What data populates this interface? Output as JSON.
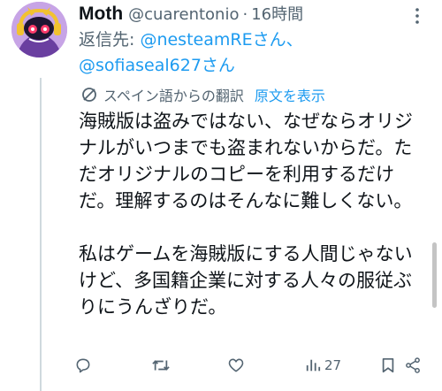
{
  "tweet": {
    "author_name": "Moth",
    "handle": "@cuarentonio",
    "separator": "·",
    "time": "16時間",
    "reply_prefix": "返信先: ",
    "mention_1": "@nesteamREさん、",
    "mention_2": "@sofiaseal627さん",
    "translated_from": "スペイン語からの翻訳",
    "show_original": "原文を表示",
    "paragraph_1": "海賊版は盗みではない、なぜならオリジナルがいつまでも盗まれないからだ。ただオリジナルのコピーを利用するだけだ。理解するのはそんなに難しくない。",
    "paragraph_2": "私はゲームを海賊版にする人間じゃないけど、多国籍企業に対する人々の服従ぶりにうんざりだ。",
    "views_count": "27"
  },
  "icons": [
    "more-icon",
    "translate-icon",
    "reply-icon",
    "retweet-icon",
    "like-icon",
    "views-icon",
    "bookmark-icon",
    "share-icon"
  ],
  "colors": {
    "link": "#1d9bf0",
    "secondary_text": "#536471",
    "primary_text": "#0f1419"
  }
}
